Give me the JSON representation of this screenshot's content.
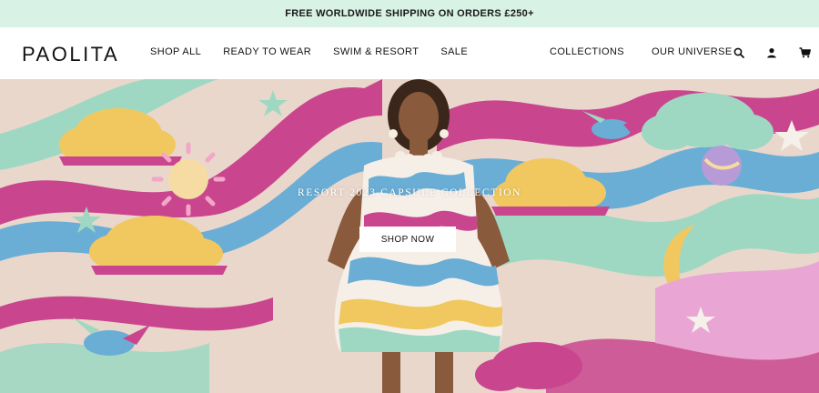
{
  "promo": {
    "text": "FREE WORLDWIDE SHIPPING ON ORDERS £250+"
  },
  "brand": {
    "logo": "PAOLITA"
  },
  "nav": {
    "left": [
      {
        "label": "SHOP ALL"
      },
      {
        "label": "READY TO WEAR"
      },
      {
        "label": "SWIM & RESORT"
      },
      {
        "label": "SALE"
      }
    ],
    "right": [
      {
        "label": "COLLECTIONS"
      },
      {
        "label": "OUR UNIVERSE"
      }
    ]
  },
  "header_icons": [
    "search-icon",
    "account-icon",
    "cart-icon"
  ],
  "hero": {
    "tagline": "RESORT 2023 CAPSULE COLLECTION",
    "cta": "SHOP NOW"
  },
  "colors": {
    "promo_bg": "#d8f3e6",
    "wall_bg": "#ead7cc",
    "mint": "#9fd8c2",
    "pink": "#c9468f",
    "yellow": "#f1c85f",
    "blue": "#6aaed6"
  }
}
